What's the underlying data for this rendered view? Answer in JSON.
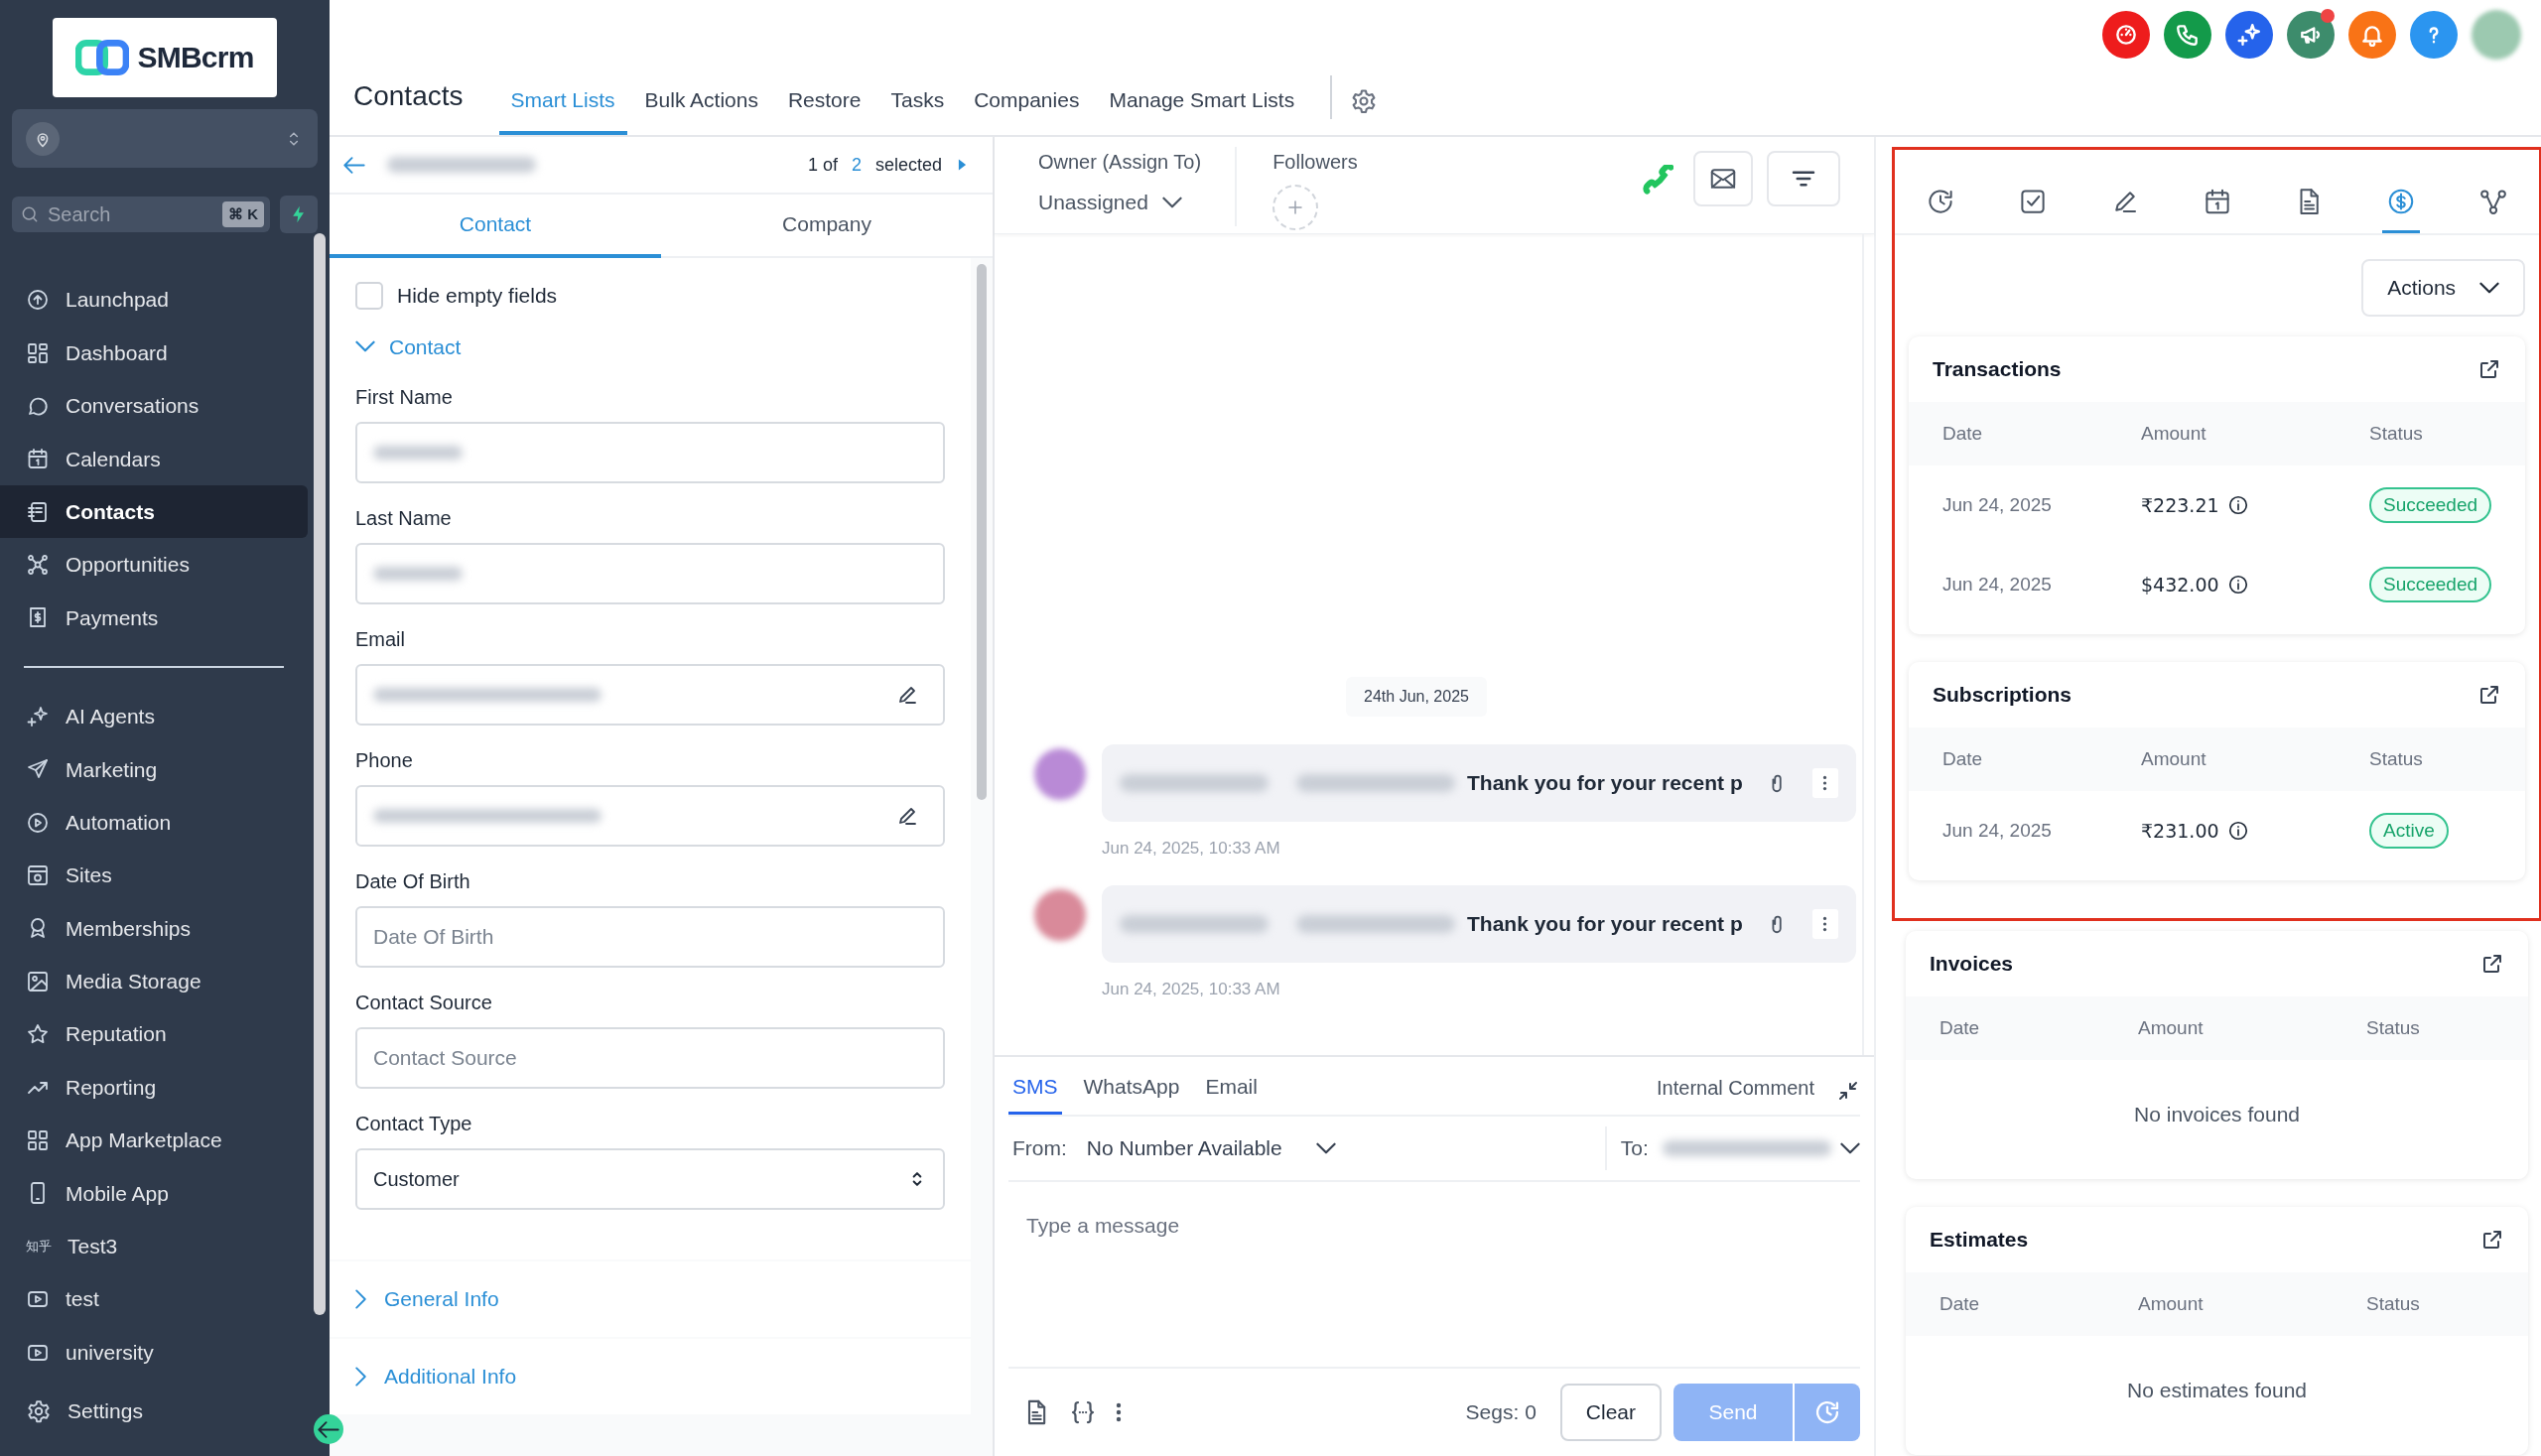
{
  "sidebar": {
    "logo": "SMBcrm",
    "search": {
      "placeholder": "Search",
      "shortcut": "⌘ K"
    },
    "main_items": [
      {
        "label": "Launchpad",
        "selected": false
      },
      {
        "label": "Dashboard",
        "selected": false
      },
      {
        "label": "Conversations",
        "selected": false
      },
      {
        "label": "Calendars",
        "selected": false
      },
      {
        "label": "Contacts",
        "selected": true
      },
      {
        "label": "Opportunities",
        "selected": false
      },
      {
        "label": "Payments",
        "selected": false
      }
    ],
    "secondary_items": [
      {
        "label": "AI Agents",
        "selected": false
      },
      {
        "label": "Marketing",
        "selected": false
      },
      {
        "label": "Automation",
        "selected": false
      },
      {
        "label": "Sites",
        "selected": false
      },
      {
        "label": "Memberships",
        "selected": false
      },
      {
        "label": "Media Storage",
        "selected": false
      },
      {
        "label": "Reputation",
        "selected": false
      },
      {
        "label": "Reporting",
        "selected": false
      },
      {
        "label": "App Marketplace",
        "selected": false
      },
      {
        "label": "Mobile App",
        "selected": false
      },
      {
        "label": "Test3",
        "icon_text": "知乎",
        "selected": false
      },
      {
        "label": "test",
        "selected": false
      },
      {
        "label": "university",
        "selected": false
      }
    ],
    "settings": "Settings"
  },
  "header": {
    "title": "Contacts",
    "tabs": [
      {
        "label": "Smart Lists",
        "selected": true
      },
      {
        "label": "Bulk Actions",
        "selected": false
      },
      {
        "label": "Restore",
        "selected": false
      },
      {
        "label": "Tasks",
        "selected": false
      },
      {
        "label": "Companies",
        "selected": false
      },
      {
        "label": "Manage Smart Lists",
        "selected": false
      }
    ]
  },
  "record_nav": {
    "position": "1 of",
    "total": "2",
    "suffix": "selected"
  },
  "detail_tabs": [
    {
      "label": "Contact",
      "selected": true
    },
    {
      "label": "Company",
      "selected": false
    }
  ],
  "hide_empty_fields": {
    "label": "Hide empty fields",
    "checked": false
  },
  "contact_section": {
    "label": "Contact",
    "expanded": true
  },
  "fields": [
    {
      "label": "First Name",
      "kind": "blurred"
    },
    {
      "label": "Last Name",
      "kind": "blurred"
    },
    {
      "label": "Email",
      "kind": "blurred_edit"
    },
    {
      "label": "Phone",
      "kind": "blurred_edit"
    },
    {
      "label": "Date Of Birth",
      "kind": "input",
      "placeholder": "Date Of Birth"
    },
    {
      "label": "Contact Source",
      "kind": "input",
      "placeholder": "Contact Source"
    },
    {
      "label": "Contact Type",
      "kind": "select",
      "value": "Customer"
    }
  ],
  "collapsed_sections": [
    {
      "label": "General Info",
      "expanded": false
    },
    {
      "label": "Additional Info",
      "expanded": false
    }
  ],
  "conversation": {
    "owner_label": "Owner (Assign To)",
    "owner_value": "Unassigned",
    "followers_label": "Followers",
    "date_divider": "24th Jun, 2025",
    "messages": [
      {
        "text": "Thank you for your recent p",
        "time": "Jun 24, 2025, 10:33 AM",
        "color": "#b98ad6"
      },
      {
        "text": "Thank you for your recent p",
        "time": "Jun 24, 2025, 10:33 AM",
        "color": "#d98a9a"
      }
    ]
  },
  "composer": {
    "channels": [
      {
        "label": "SMS",
        "selected": true
      },
      {
        "label": "WhatsApp",
        "selected": false
      },
      {
        "label": "Email",
        "selected": false
      }
    ],
    "internal_comment": "Internal Comment",
    "from_label": "From:",
    "from_value": "No Number Available",
    "to_label": "To:",
    "placeholder": "Type a message",
    "segments": "Segs: 0",
    "clear": "Clear",
    "send": "Send"
  },
  "payments_panel": {
    "tabs": [
      {
        "selected": false
      },
      {
        "selected": false
      },
      {
        "selected": false
      },
      {
        "selected": false
      },
      {
        "selected": false
      },
      {
        "selected": true
      },
      {
        "selected": false
      }
    ],
    "actions": "Actions",
    "cards": [
      {
        "title": "Transactions",
        "columns": [
          "Date",
          "Amount",
          "Status"
        ],
        "rows": [
          [
            "Jun 24, 2025",
            "₹223.21",
            "Succeeded"
          ],
          [
            "Jun 24, 2025",
            "$432.00",
            "Succeeded"
          ]
        ]
      },
      {
        "title": "Subscriptions",
        "columns": [
          "Date",
          "Amount",
          "Status"
        ],
        "rows": [
          [
            "Jun 24, 2025",
            "₹231.00",
            "Active"
          ]
        ]
      },
      {
        "title": "Invoices",
        "columns": [
          "Date",
          "Amount",
          "Status"
        ],
        "empty": "No invoices found"
      },
      {
        "title": "Estimates",
        "columns": [
          "Date",
          "Amount",
          "Status"
        ],
        "empty": "No estimates found"
      }
    ]
  }
}
